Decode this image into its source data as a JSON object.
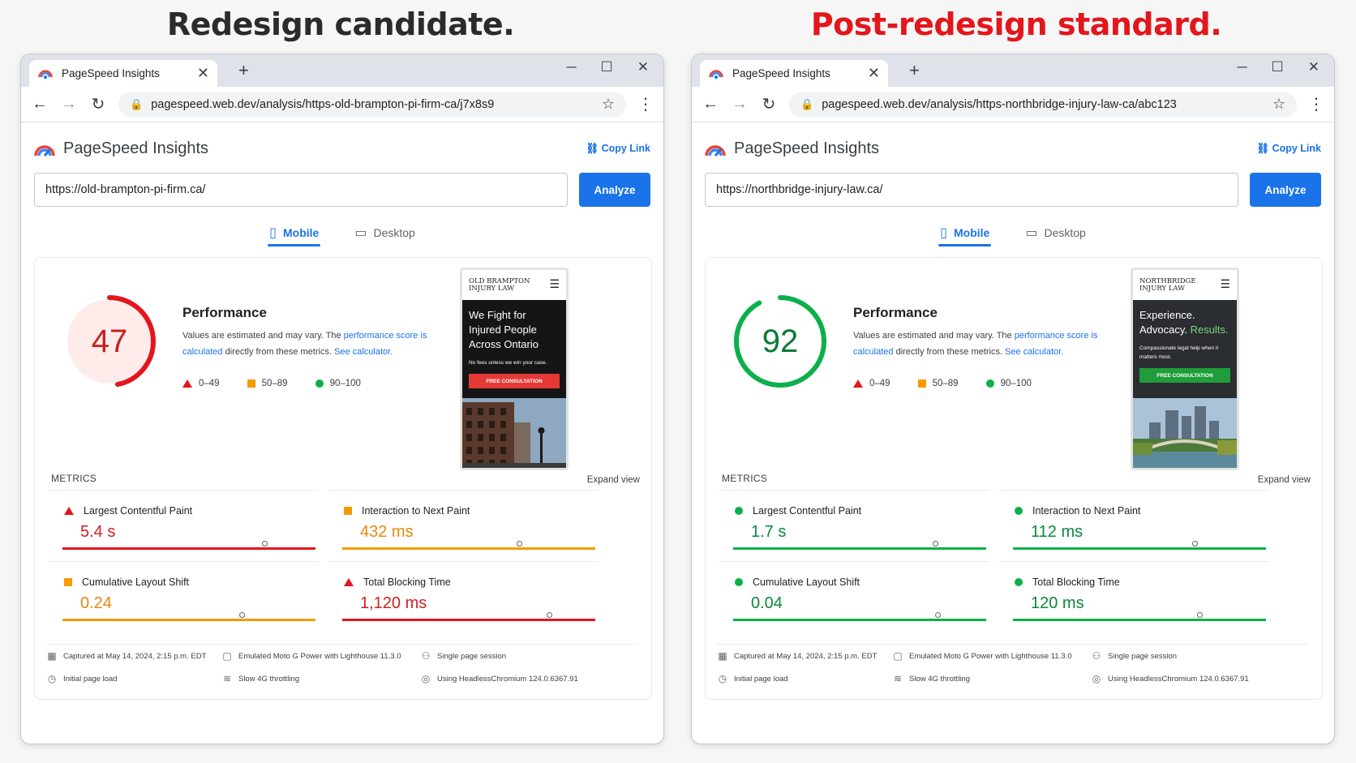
{
  "headings": {
    "left": "Redesign candidate.",
    "right": "Post-redesign standard."
  },
  "colors": {
    "fail": "#e3161c",
    "average": "#f59b00",
    "pass": "#0cb04a",
    "accent": "#1a73e8"
  },
  "legend": {
    "fail": "0–49",
    "average": "50–89",
    "pass": "90–100"
  },
  "common": {
    "tab_title": "PageSpeed Insights",
    "app_title": "PageSpeed Insights",
    "copy_link": "Copy Link",
    "analyze": "Analyze",
    "mobile": "Mobile",
    "desktop": "Desktop",
    "performance": "Performance",
    "desc_1": "Values are estimated and may vary. The ",
    "desc_link": "performance score is calculated",
    "desc_2": " directly from these metrics. ",
    "desc_link2": "See calculator.",
    "metrics_label": "METRICS",
    "expand_view": "Expand view",
    "metric_names": [
      "Largest Contentful Paint",
      "Interaction to Next Paint",
      "Cumulative Layout Shift",
      "Total Blocking Time"
    ],
    "footer": {
      "captured": "Captured at May 14, 2024, 2:15 p.m. EDT",
      "device": "Emulated Moto G Power with Lighthouse 11.3.0",
      "session": "Single page session",
      "load": "Initial page load",
      "throttling": "Slow 4G throttling",
      "browser": "Using HeadlessChromium 124.0.6367.91"
    }
  },
  "left": {
    "address": "pagespeed.web.dev/analysis/https-old-brampton-pi-firm-ca/j7x8s9",
    "input_url": "https://old-brampton-pi-firm.ca/",
    "score": 47,
    "score_rating": "fail",
    "site": {
      "brand_line1": "OLD BRAMPTON",
      "brand_line2": "INJURY LAW",
      "headline": "We Fight for Injured People Across Ontario",
      "subline": "No fees unless we win your case.",
      "cta": "FREE CONSULTATION",
      "cta_color": "#e53935",
      "hero_color": "#151515"
    },
    "metrics": [
      {
        "value": "5.4 s",
        "rating": "fail",
        "position": 0.8
      },
      {
        "value": "432 ms",
        "rating": "average",
        "position": 0.7
      },
      {
        "value": "0.24",
        "rating": "average",
        "position": 0.71
      },
      {
        "value": "1,120 ms",
        "rating": "fail",
        "position": 0.82
      }
    ]
  },
  "right": {
    "address": "pagespeed.web.dev/analysis/https-northbridge-injury-law-ca/abc123",
    "input_url": "https://northbridge-injury-law.ca/",
    "score": 92,
    "score_rating": "pass",
    "site": {
      "brand_line1": "NORTHBRIDGE",
      "brand_line2": "INJURY LAW",
      "headline": "Experience. Advocacy.",
      "headline_accent": "Results.",
      "subline": "Compassionate legal help when it matters most.",
      "cta": "FREE CONSULTATION",
      "cta_color": "#1f9d3a",
      "hero_color": "#2a2d31"
    },
    "metrics": [
      {
        "value": "1.7 s",
        "rating": "pass",
        "position": 0.8
      },
      {
        "value": "112 ms",
        "rating": "pass",
        "position": 0.72
      },
      {
        "value": "0.04",
        "rating": "pass",
        "position": 0.81
      },
      {
        "value": "120 ms",
        "rating": "pass",
        "position": 0.74
      }
    ]
  }
}
